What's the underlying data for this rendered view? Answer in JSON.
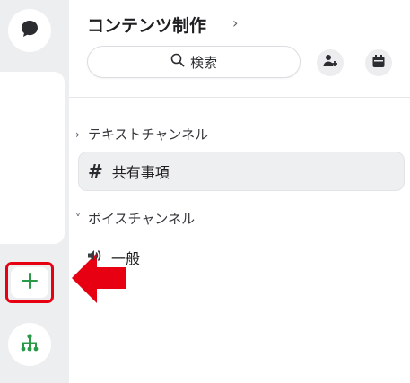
{
  "header": {
    "server_name": "コンテンツ制作",
    "chevron": "›",
    "search_label": "検索"
  },
  "categories": [
    {
      "label": "テキストチャンネル",
      "chevron": "›",
      "channels": [
        {
          "prefix": "#",
          "name": "共有事項",
          "selected": true
        }
      ]
    },
    {
      "label": "ボイスチャンネル",
      "chevron": "˅",
      "channels": [
        {
          "name": "一般"
        }
      ]
    }
  ],
  "rail": {
    "icons": [
      "chat-bubble-icon",
      "add-server-icon",
      "directory-icon"
    ],
    "add_color": "#2b9a48",
    "highlight_color": "#e60012"
  },
  "colors": {
    "arrow": "#e60012",
    "accent_green": "#2b9a48"
  }
}
